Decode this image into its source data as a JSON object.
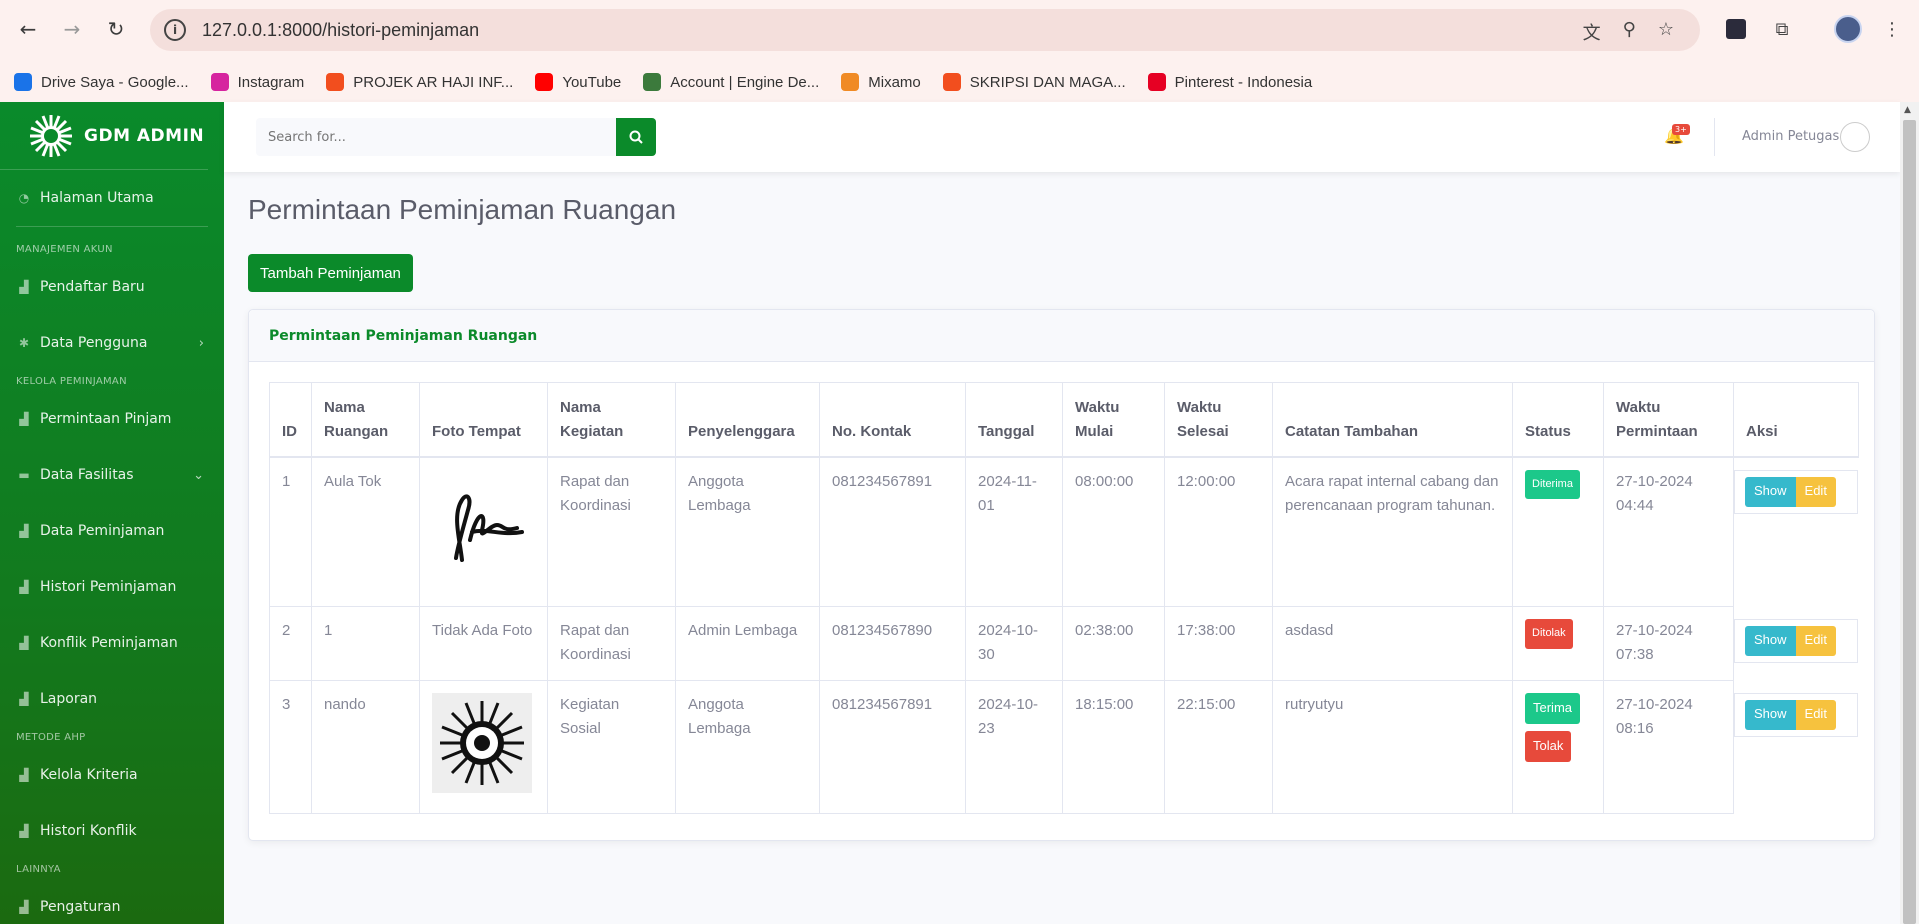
{
  "browser": {
    "url": "127.0.0.1:8000/histori-peminjaman",
    "bookmarks": [
      {
        "label": "Drive Saya - Google...",
        "color": "#1a73e8"
      },
      {
        "label": "Instagram",
        "color": "#d6249f"
      },
      {
        "label": "PROJEK AR HAJI INF...",
        "color": "#f24e1e"
      },
      {
        "label": "YouTube",
        "color": "#ff0000"
      },
      {
        "label": "Account | Engine De...",
        "color": "#3c7a3c"
      },
      {
        "label": "Mixamo",
        "color": "#f08a24"
      },
      {
        "label": "SKRIPSI DAN MAGA...",
        "color": "#f24e1e"
      },
      {
        "label": "Pinterest - Indonesia",
        "color": "#e60023"
      }
    ]
  },
  "sidebar": {
    "brand": "GDM ADMIN",
    "items": [
      {
        "type": "item",
        "label": "Halaman Utama",
        "icon": "dashboard-icon"
      },
      {
        "type": "heading",
        "label": "MANAJEMEN AKUN"
      },
      {
        "type": "item",
        "label": "Pendaftar Baru",
        "icon": "chart-icon"
      },
      {
        "type": "item",
        "label": "Data Pengguna",
        "icon": "cog-icon",
        "chevron": "›"
      },
      {
        "type": "heading",
        "label": "KELOLA PEMINJAMAN"
      },
      {
        "type": "item",
        "label": "Permintaan Pinjam",
        "icon": "chart-icon"
      },
      {
        "type": "item",
        "label": "Data Fasilitas",
        "icon": "folder-icon",
        "chevron": "⌄"
      },
      {
        "type": "item",
        "label": "Data Peminjaman",
        "icon": "chart-icon"
      },
      {
        "type": "item",
        "label": "Histori Peminjaman",
        "icon": "chart-icon"
      },
      {
        "type": "item",
        "label": "Konflik Peminjaman",
        "icon": "chart-icon"
      },
      {
        "type": "item",
        "label": "Laporan",
        "icon": "chart-icon"
      },
      {
        "type": "heading",
        "label": "METODE AHP"
      },
      {
        "type": "item",
        "label": "Kelola Kriteria",
        "icon": "chart-icon"
      },
      {
        "type": "item",
        "label": "Histori Konflik",
        "icon": "chart-icon"
      },
      {
        "type": "heading",
        "label": "LAINNYA"
      },
      {
        "type": "item",
        "label": "Pengaturan",
        "icon": "chart-icon"
      }
    ]
  },
  "topbar": {
    "search_placeholder": "Search for...",
    "alerts_badge": "3+",
    "user_name": "Admin Petugas"
  },
  "main": {
    "page_title": "Permintaan Peminjaman Ruangan",
    "add_button": "Tambah Peminjaman",
    "card_title": "Permintaan Peminjaman Ruangan",
    "columns": [
      "ID",
      "Nama Ruangan",
      "Foto Tempat",
      "Nama Kegiatan",
      "Penyelenggara",
      "No. Kontak",
      "Tanggal",
      "Waktu Mulai",
      "Waktu Selesai",
      "Catatan Tambahan",
      "Status",
      "Waktu Permintaan",
      "Aksi"
    ],
    "rows": [
      {
        "id": "1",
        "ruangan": "Aula Tok",
        "foto": "signature",
        "foto_text": "",
        "kegiatan": "Rapat dan Koordinasi",
        "penyelenggara": "Anggota Lembaga",
        "kontak": "081234567891",
        "tanggal": "2024-11-01",
        "mulai": "08:00:00",
        "selesai": "12:00:00",
        "catatan": "Acara rapat internal cabang dan perencanaan program tahunan.",
        "status": "Diterima",
        "status_color": "#1cc88a",
        "waktu": "27-10-2024 04:44"
      },
      {
        "id": "2",
        "ruangan": "1",
        "foto": "none",
        "foto_text": "Tidak Ada Foto",
        "kegiatan": "Rapat dan Koordinasi",
        "penyelenggara": "Admin Lembaga",
        "kontak": "081234567890",
        "tanggal": "2024-10-30",
        "mulai": "02:38:00",
        "selesai": "17:38:00",
        "catatan": "asdasd",
        "status": "Ditolak",
        "status_color": "#e74a3b",
        "waktu": "27-10-2024 07:38"
      },
      {
        "id": "3",
        "ruangan": "nando",
        "foto": "emblem",
        "foto_text": "",
        "kegiatan": "Kegiatan Sosial",
        "penyelenggara": "Anggota Lembaga",
        "kontak": "081234567891",
        "tanggal": "2024-10-23",
        "mulai": "18:15:00",
        "selesai": "22:15:00",
        "catatan": "rutryutyu",
        "status": "",
        "accept_label": "Terima",
        "reject_label": "Tolak",
        "waktu": "27-10-2024 08:16"
      }
    ],
    "show_label": "Show",
    "edit_label": "Edit"
  }
}
